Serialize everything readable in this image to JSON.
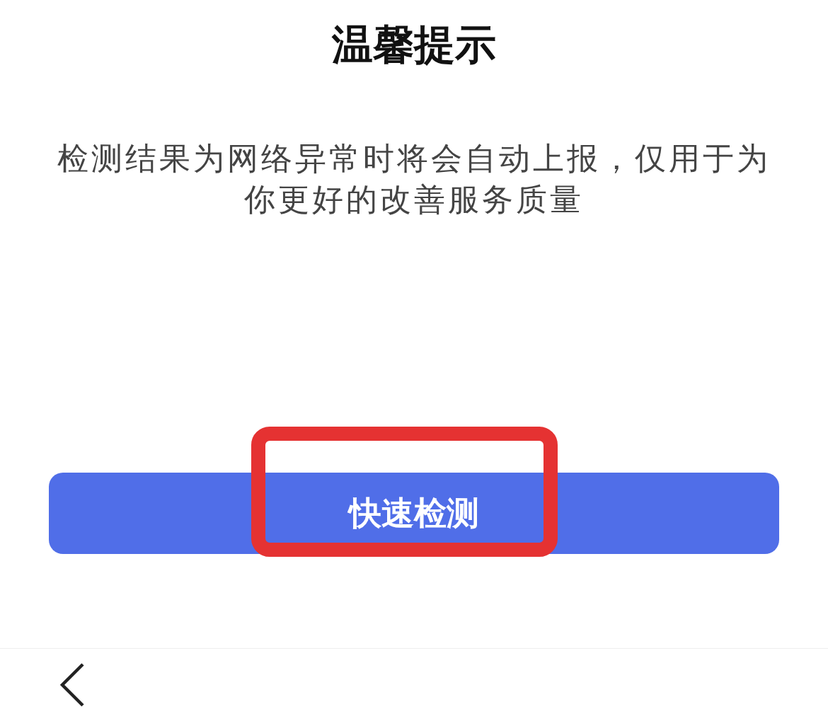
{
  "dialog": {
    "title": "温馨提示",
    "message": "检测结果为网络异常时将会自动上报，仅用于为你更好的改善服务质量",
    "button": "快速检测"
  }
}
